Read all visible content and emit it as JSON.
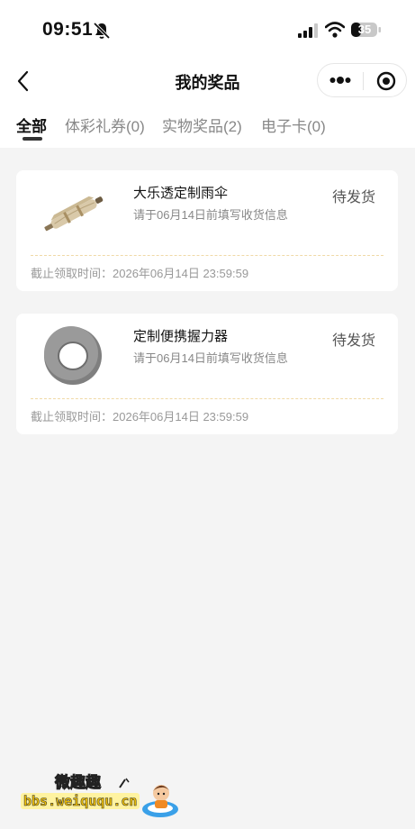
{
  "status_bar": {
    "time": "09:51",
    "battery": "35",
    "icons": [
      "bell-muted-icon",
      "cellular-signal-icon",
      "wifi-icon",
      "battery-icon"
    ]
  },
  "navbar": {
    "title": "我的奖品",
    "icons": [
      "back-arrow-icon",
      "more-dots-icon",
      "target-circle-icon"
    ]
  },
  "tabs": [
    {
      "label": "全部",
      "active": true
    },
    {
      "label": "体彩礼券(0)",
      "active": false
    },
    {
      "label": "实物奖品(2)",
      "active": false
    },
    {
      "label": "电子卡(0)",
      "active": false
    }
  ],
  "prizes": [
    {
      "name": "大乐透定制雨伞",
      "hint": "请于06月14日前填写收货信息",
      "status": "待发货",
      "deadline": "截止领取时间：2026年06月14日 23:59:59",
      "image": "umbrella"
    },
    {
      "name": "定制便携握力器",
      "hint": "请于06月14日前填写收货信息",
      "status": "待发货",
      "deadline": "截止领取时间：2026年06月14日 23:59:59",
      "image": "grip-ring"
    }
  ],
  "watermark": {
    "title": "微趣趣",
    "url": "bbs.weiququ.cn"
  },
  "colors": {
    "background": "#f4f4f4",
    "card": "#ffffff",
    "dashed_divider": "#f0d9a6",
    "active_tab": "#111111",
    "inactive_tab": "#888888"
  }
}
